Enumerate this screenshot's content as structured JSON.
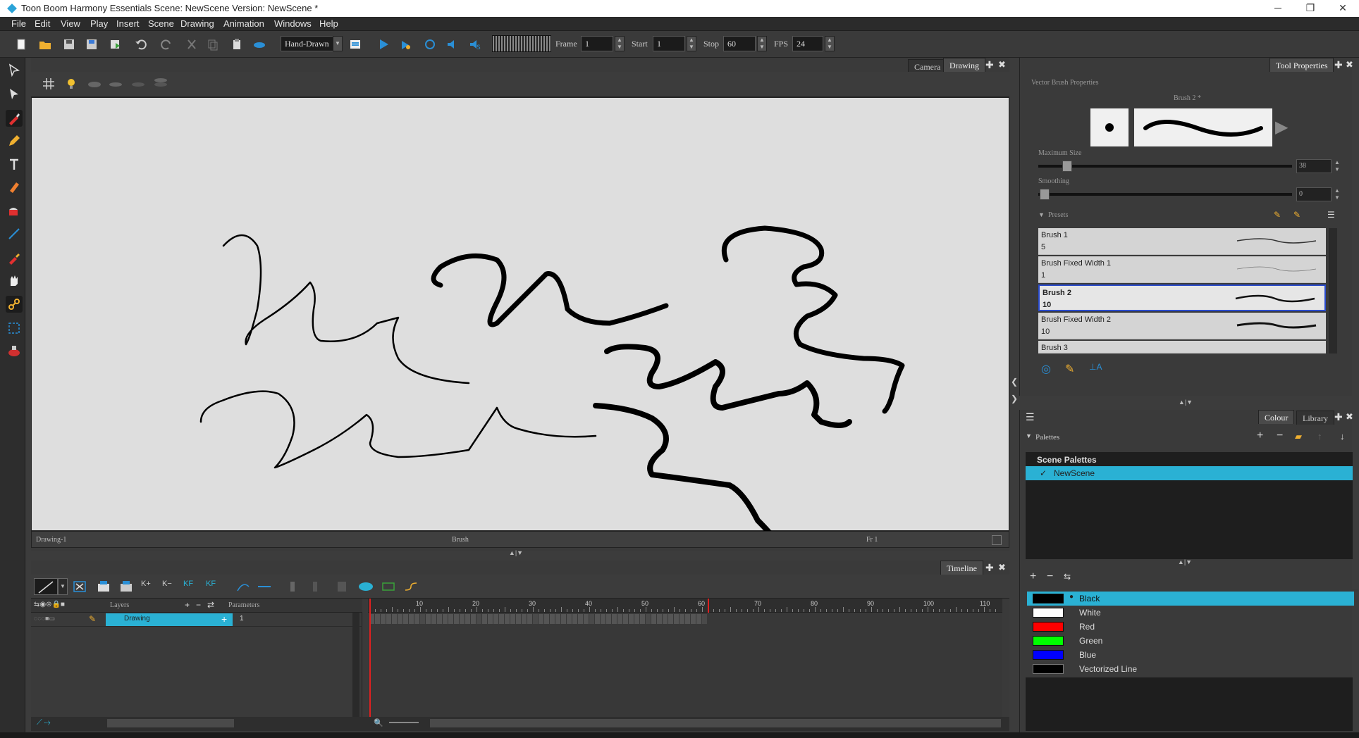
{
  "window": {
    "title": "Toon Boom Harmony Essentials Scene: NewScene Version: NewScene *",
    "minimize": "─",
    "restore": "❐",
    "close": "✕"
  },
  "menu": [
    "File",
    "Edit",
    "View",
    "Play",
    "Insert",
    "Scene",
    "Drawing",
    "Animation",
    "Windows",
    "Help"
  ],
  "toolbar": {
    "mode_select": "Hand-Drawn",
    "frame_label": "Frame",
    "frame_value": "1",
    "start_label": "Start",
    "start_value": "1",
    "stop_label": "Stop",
    "stop_value": "60",
    "fps_label": "FPS",
    "fps_value": "24"
  },
  "view": {
    "tabs": [
      "Camera",
      "Drawing"
    ],
    "active_tab": "Drawing",
    "status_left": "Drawing-1",
    "status_center": "Brush",
    "status_right": "Fr 1"
  },
  "timeline": {
    "tab": "Timeline",
    "layers_header": "Layers",
    "parameters_header": "Parameters",
    "layer_name": "Drawing",
    "layer_param": "1",
    "frame_ticks": [
      "10",
      "20",
      "30",
      "40",
      "50",
      "60",
      "70",
      "80",
      "90",
      "100",
      "110"
    ],
    "current_frame": 1,
    "stop_frame": 60
  },
  "tool_properties": {
    "tab": "Tool Properties",
    "section": "Vector Brush Properties",
    "brush_name": "Brush 2 *",
    "max_size_label": "Maximum Size",
    "max_size_value": "38",
    "smoothing_label": "Smoothing",
    "smoothing_value": "0",
    "presets_label": "Presets",
    "presets": [
      {
        "name": "Brush 1",
        "size": "5"
      },
      {
        "name": "Brush Fixed Width 1",
        "size": "1"
      },
      {
        "name": "Brush 2",
        "size": "10"
      },
      {
        "name": "Brush Fixed Width 2",
        "size": "10"
      },
      {
        "name": "Brush 3",
        "size": ""
      }
    ]
  },
  "colour_panel": {
    "tabs": [
      "Colour",
      "Library"
    ],
    "palettes_label": "Palettes",
    "scene_palettes_label": "Scene Palettes",
    "palette_name": "NewScene",
    "colours": [
      {
        "name": "Black",
        "hex": "#000000"
      },
      {
        "name": "White",
        "hex": "#ffffff"
      },
      {
        "name": "Red",
        "hex": "#ff0000"
      },
      {
        "name": "Green",
        "hex": "#00ff00"
      },
      {
        "name": "Blue",
        "hex": "#0000ff"
      },
      {
        "name": "Vectorized Line",
        "hex": "#000000"
      }
    ]
  },
  "theme": {
    "accent": "#2ab1d4",
    "selection_border": "#2a4bcc",
    "playhead": "#e02020"
  }
}
